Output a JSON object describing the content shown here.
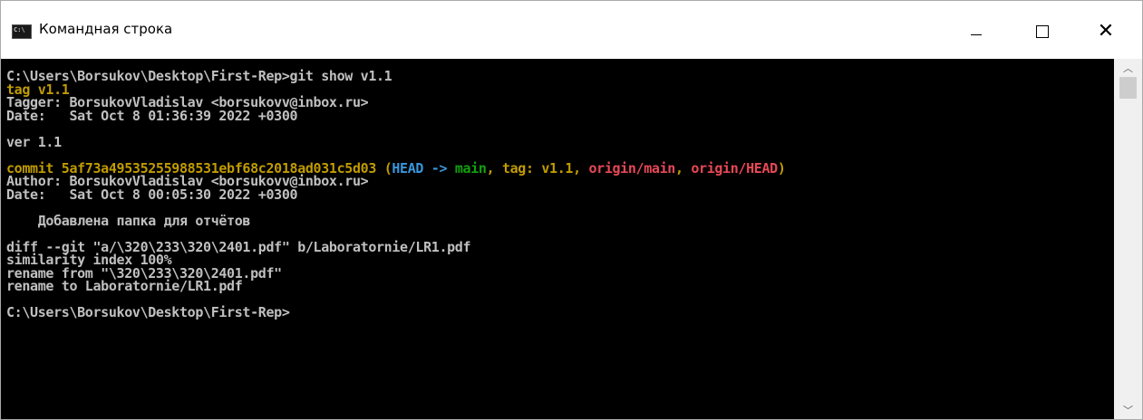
{
  "window": {
    "title": "Командная строка",
    "icon": "cmd-icon",
    "controls": {
      "minimize": "minimize-icon",
      "maximize": "maximize-icon",
      "close": "close-icon"
    }
  },
  "colors": {
    "background": "#000000",
    "text": "#c0c0c0",
    "yellow": "#c19c00",
    "cyan": "#3a96dd",
    "green": "#13a10e",
    "red": "#e74856"
  },
  "console": {
    "lines": [
      [
        {
          "t": "C:\\Users\\Borsukov\\Desktop\\First-Rep>git show v1.1",
          "c": "gray"
        }
      ],
      [
        {
          "t": "tag v1.1",
          "c": "yellow"
        }
      ],
      [
        {
          "t": "Tagger: BorsukovVladislav <borsukovv@inbox.ru>",
          "c": "gray"
        }
      ],
      [
        {
          "t": "Date:   Sat Oct 8 01:36:39 2022 +0300",
          "c": "gray"
        }
      ],
      [
        {
          "t": "",
          "c": "gray"
        }
      ],
      [
        {
          "t": "ver 1.1",
          "c": "gray"
        }
      ],
      [
        {
          "t": "",
          "c": "gray"
        }
      ],
      [
        {
          "t": "commit 5af73a49535255988531ebf68c2018ad031c5d03 ",
          "c": "yellow"
        },
        {
          "t": "(",
          "c": "yellow"
        },
        {
          "t": "HEAD -> ",
          "c": "cyan"
        },
        {
          "t": "main",
          "c": "green"
        },
        {
          "t": ", ",
          "c": "yellow"
        },
        {
          "t": "tag: v1.1",
          "c": "yellow"
        },
        {
          "t": ", ",
          "c": "yellow"
        },
        {
          "t": "origin/main",
          "c": "red"
        },
        {
          "t": ", ",
          "c": "yellow"
        },
        {
          "t": "origin/HEAD",
          "c": "red"
        },
        {
          "t": ")",
          "c": "yellow"
        }
      ],
      [
        {
          "t": "Author: BorsukovVladislav <borsukovv@inbox.ru>",
          "c": "gray"
        }
      ],
      [
        {
          "t": "Date:   Sat Oct 8 00:05:30 2022 +0300",
          "c": "gray"
        }
      ],
      [
        {
          "t": "",
          "c": "gray"
        }
      ],
      [
        {
          "t": "    Добавлена папка для отчётов",
          "c": "gray"
        }
      ],
      [
        {
          "t": "",
          "c": "gray"
        }
      ],
      [
        {
          "t": "diff --git \"a/\\320\\233\\320\\2401.pdf\" b/Laboratornie/LR1.pdf",
          "c": "gray"
        }
      ],
      [
        {
          "t": "similarity index 100%",
          "c": "gray"
        }
      ],
      [
        {
          "t": "rename from \"\\320\\233\\320\\2401.pdf\"",
          "c": "gray"
        }
      ],
      [
        {
          "t": "rename to Laboratornie/LR1.pdf",
          "c": "gray"
        }
      ],
      [
        {
          "t": "",
          "c": "gray"
        }
      ],
      [
        {
          "t": "C:\\Users\\Borsukov\\Desktop\\First-Rep>",
          "c": "gray"
        }
      ]
    ]
  },
  "scrollbar": {
    "up": "chevron-up-icon",
    "down": "chevron-down-icon"
  }
}
